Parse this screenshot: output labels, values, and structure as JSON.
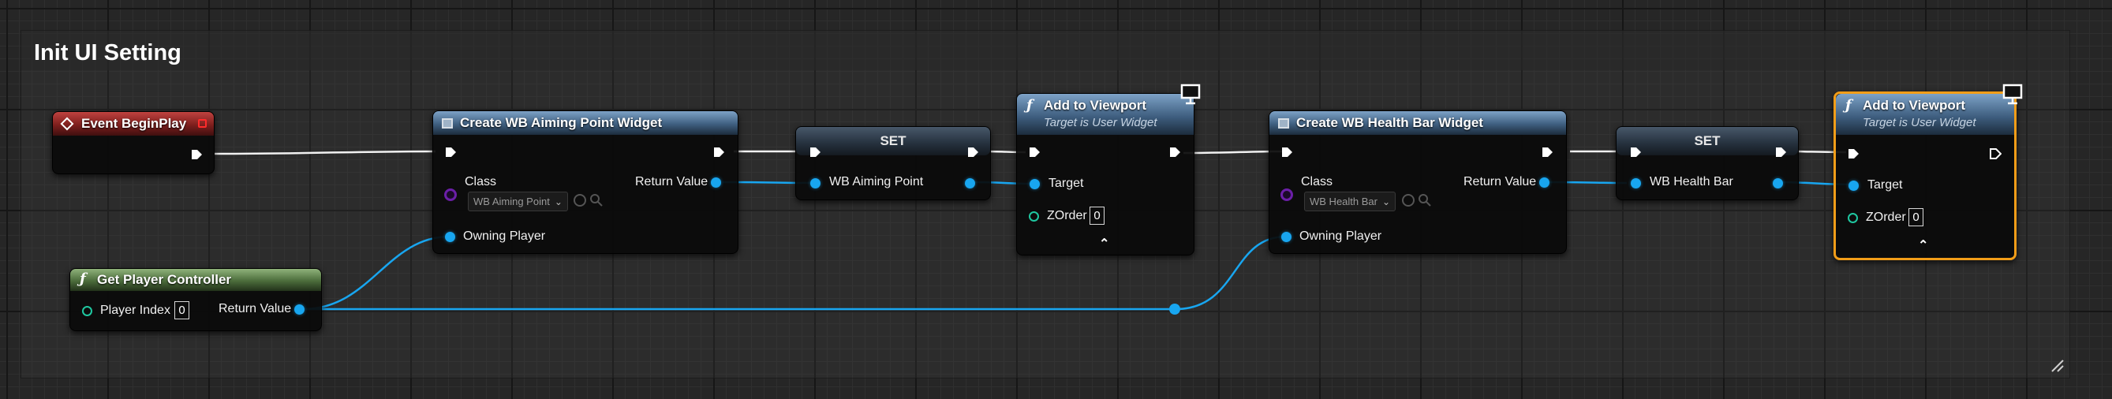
{
  "comment": {
    "title": "Init UI Setting"
  },
  "nodes": {
    "event_begin_play": {
      "title": "Event BeginPlay"
    },
    "create_aiming": {
      "title": "Create WB Aiming Point Widget",
      "class_label": "Class",
      "class_value": "WB Aiming Point",
      "return_label": "Return Value",
      "owning_label": "Owning Player"
    },
    "set_aiming": {
      "title": "SET",
      "var_label": "WB Aiming Point"
    },
    "add_viewport_1": {
      "title": "Add to Viewport",
      "subtitle": "Target is User Widget",
      "target_label": "Target",
      "zorder_label": "ZOrder",
      "zorder_value": "0"
    },
    "create_health": {
      "title": "Create WB Health Bar Widget",
      "class_label": "Class",
      "class_value": "WB Health Bar",
      "return_label": "Return Value",
      "owning_label": "Owning Player"
    },
    "set_health": {
      "title": "SET",
      "var_label": "WB Health Bar"
    },
    "add_viewport_2": {
      "title": "Add to Viewport",
      "subtitle": "Target is User Widget",
      "target_label": "Target",
      "zorder_label": "ZOrder",
      "zorder_value": "0"
    },
    "get_player_controller": {
      "title": "Get Player Controller",
      "index_label": "Player Index",
      "index_value": "0",
      "return_label": "Return Value"
    }
  },
  "colors": {
    "exec_wire": "#ffffff",
    "object_wire": "#18a6f0",
    "selection": "#f29d18",
    "function_header": "#4f7296",
    "event_header": "#9a2a27",
    "pure_header": "#5f8a4a"
  },
  "icons": {
    "function": "function-f-icon",
    "event": "event-diamond-icon",
    "widget": "widget-class-icon",
    "monitor": "viewport-monitor-icon"
  }
}
